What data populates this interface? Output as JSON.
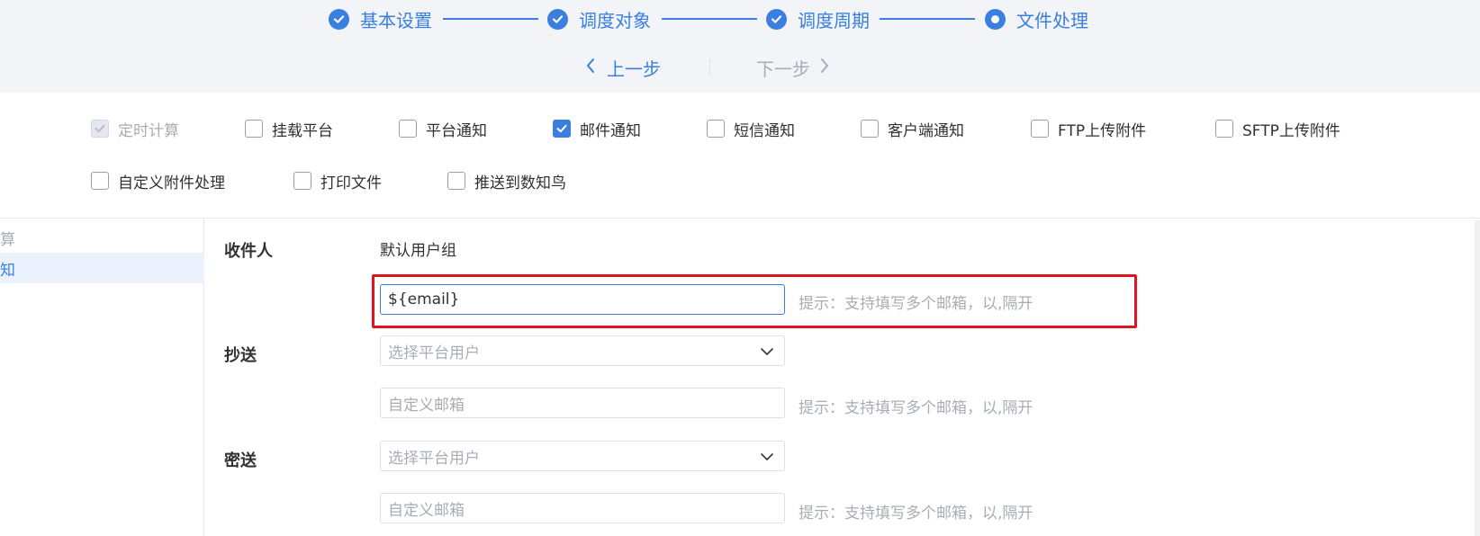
{
  "steps": [
    {
      "label": "基本设置",
      "state": "done"
    },
    {
      "label": "调度对象",
      "state": "done"
    },
    {
      "label": "调度周期",
      "state": "done"
    },
    {
      "label": "文件处理",
      "state": "current"
    }
  ],
  "nav": {
    "prev_label": "上一步",
    "next_label": "下一步"
  },
  "options": [
    {
      "label": "定时计算",
      "checked": true,
      "disabled": true
    },
    {
      "label": "挂载平台",
      "checked": false
    },
    {
      "label": "平台通知",
      "checked": false
    },
    {
      "label": "邮件通知",
      "checked": true
    },
    {
      "label": "短信通知",
      "checked": false
    },
    {
      "label": "客户端通知",
      "checked": false
    },
    {
      "label": "FTP上传附件",
      "checked": false
    },
    {
      "label": "SFTP上传附件",
      "checked": false
    },
    {
      "label": "自定义附件处理",
      "checked": false
    },
    {
      "label": "打印文件",
      "checked": false
    },
    {
      "label": "推送到数知鸟",
      "checked": false
    }
  ],
  "side": {
    "items": [
      "算",
      "知"
    ]
  },
  "form": {
    "recipient_label": "收件人",
    "recipient_group": "默认用户组",
    "recipient_email_value": "${email}",
    "hint": "提示：支持填写多个邮箱，以,隔开",
    "cc_label": "抄送",
    "cc_select_placeholder": "选择平台用户",
    "cc_email_placeholder": "自定义邮箱",
    "bcc_label": "密送",
    "bcc_select_placeholder": "选择平台用户",
    "bcc_email_placeholder": "自定义邮箱"
  },
  "colors": {
    "accent": "#3a7fdf",
    "highlight": "#e0141e"
  }
}
